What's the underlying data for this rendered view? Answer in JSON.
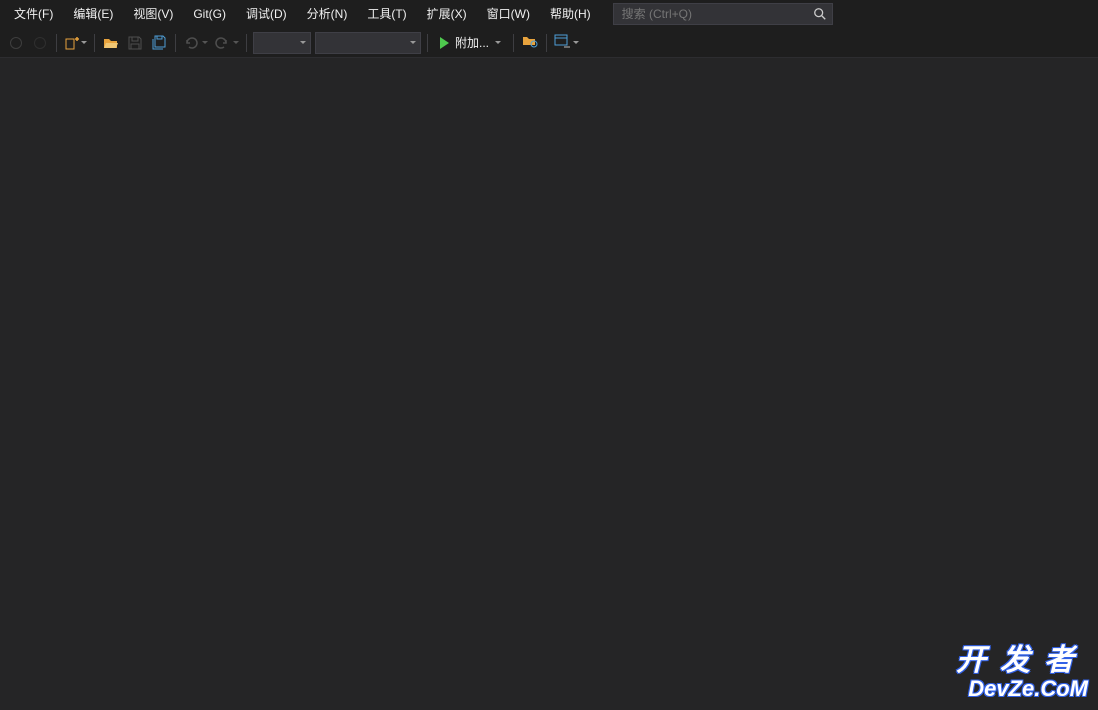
{
  "menu": {
    "file": "文件(F)",
    "edit": "编辑(E)",
    "view": "视图(V)",
    "git": "Git(G)",
    "debug": "调试(D)",
    "analyze": "分析(N)",
    "tools": "工具(T)",
    "extensions": "扩展(X)",
    "window": "窗口(W)",
    "help": "帮助(H)"
  },
  "search": {
    "placeholder": "搜索 (Ctrl+Q)"
  },
  "toolbar": {
    "attach_label": "附加..."
  },
  "watermark": {
    "line1": "开发者",
    "line2": "DevZe.CoM"
  }
}
